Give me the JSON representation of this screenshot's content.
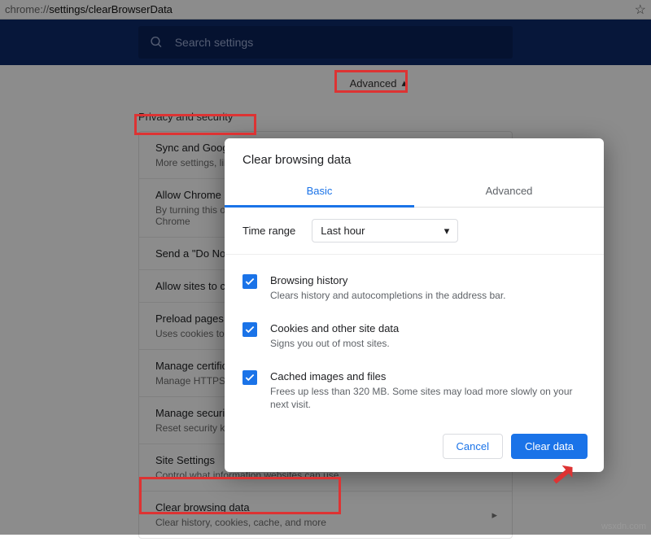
{
  "addr": {
    "prefix": "chrome://",
    "path": "settings/clearBrowserData"
  },
  "search": {
    "placeholder": "Search settings"
  },
  "advanced_label": "Advanced",
  "section_title": "Privacy and security",
  "rows": [
    {
      "title": "Sync and Google services",
      "sub": "More settings, like sync"
    },
    {
      "title": "Allow Chrome sign-in",
      "sub": "By turning this off, you can sign in to Google sites without signing in to Chrome"
    },
    {
      "title": "Send a \"Do Not Track\" request with your browsing traffic",
      "sub": ""
    },
    {
      "title": "Allow sites to check if you have payment methods saved",
      "sub": ""
    },
    {
      "title": "Preload pages for faster browsing and searching",
      "sub": "Uses cookies to remember preferences"
    },
    {
      "title": "Manage certificates",
      "sub": "Manage HTTPS/SSL certificates and settings"
    },
    {
      "title": "Manage security keys",
      "sub": "Reset security keys and create PINs"
    },
    {
      "title": "Site Settings",
      "sub": "Control what information websites can use"
    },
    {
      "title": "Clear browsing data",
      "sub": "Clear history, cookies, cache, and more"
    }
  ],
  "dialog": {
    "title": "Clear browsing data",
    "tabs": {
      "basic": "Basic",
      "advanced": "Advanced"
    },
    "range_label": "Time range",
    "range_value": "Last hour",
    "items": [
      {
        "title": "Browsing history",
        "sub": "Clears history and autocompletions in the address bar."
      },
      {
        "title": "Cookies and other site data",
        "sub": "Signs you out of most sites."
      },
      {
        "title": "Cached images and files",
        "sub": "Frees up less than 320 MB. Some sites may load more slowly on your next visit."
      }
    ],
    "cancel": "Cancel",
    "confirm": "Clear data"
  },
  "watermark": "wsxdn.com"
}
